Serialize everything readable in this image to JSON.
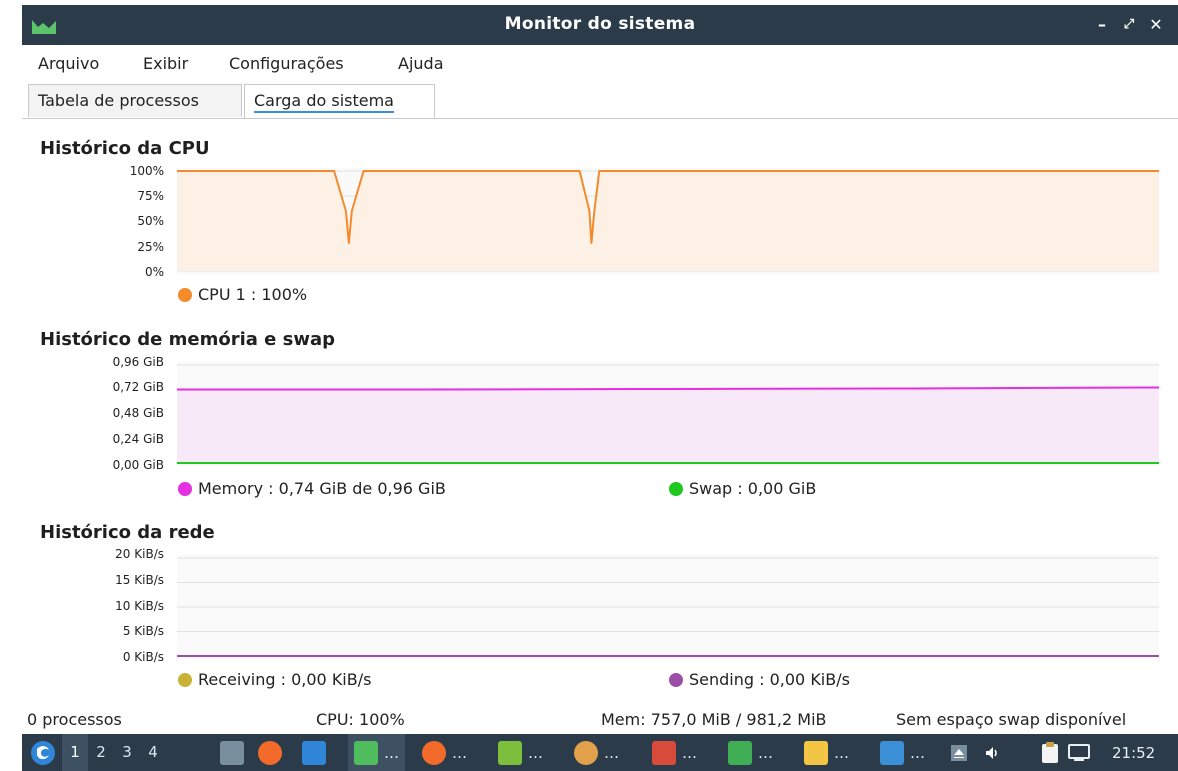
{
  "window": {
    "title": "Monitor do sistema"
  },
  "menu": [
    "Arquivo",
    "Exibir",
    "Configurações",
    "Ajuda"
  ],
  "tabs": [
    {
      "label": "Tabela de processos",
      "active": false
    },
    {
      "label": "Carga do sistema",
      "active": true
    }
  ],
  "cpu": {
    "title": "Histórico da CPU",
    "yticks": [
      "100%",
      "75%",
      "50%",
      "25%",
      "0%"
    ],
    "legend": "CPU 1 : 100%",
    "color": "#f58a2a",
    "fill": "#fdf1e6"
  },
  "memory": {
    "title": "Histórico de memória e swap",
    "yticks": [
      "0,96 GiB",
      "0,72 GiB",
      "0,48 GiB",
      "0,24 GiB",
      "0,00 GiB"
    ],
    "legend_memory": "Memory : 0,74 GiB de 0,96 GiB",
    "legend_swap": "Swap : 0,00 GiB",
    "memory_color": "#e62fe0",
    "swap_color": "#1ec81e",
    "fill": "#f7e9f7"
  },
  "network": {
    "title": "Histórico da rede",
    "yticks": [
      "20 KiB/s",
      "15 KiB/s",
      "10 KiB/s",
      "5 KiB/s",
      "0 KiB/s"
    ],
    "legend_receiving": "Receiving : 0,00 KiB/s",
    "legend_sending": "Sending : 0,00 KiB/s",
    "receiving_color": "#c9b037",
    "sending_color": "#9a4ea8"
  },
  "status": {
    "processes": "0 processos",
    "cpu": "CPU: 100%",
    "mem": "Mem: 757,0 MiB / 981,2 MiB",
    "swap": "Sem espaço swap disponível"
  },
  "taskbar": {
    "workspaces": [
      "1",
      "2",
      "3",
      "4"
    ],
    "ellipsis": "…",
    "clock": "21:52"
  },
  "chart_data": [
    {
      "type": "line",
      "title": "Histórico da CPU",
      "ylim": [
        0,
        100
      ],
      "series": [
        {
          "name": "CPU 1 : 100%",
          "x": [
            0,
            0.16,
            0.172,
            0.175,
            0.178,
            0.19,
            0.41,
            0.42,
            0.422,
            0.425,
            0.43,
            1
          ],
          "values": [
            100,
            100,
            60,
            28,
            60,
            100,
            100,
            60,
            28,
            60,
            100,
            100
          ]
        }
      ]
    },
    {
      "type": "line",
      "title": "Histórico de memória e swap",
      "ylim": [
        0,
        0.96
      ],
      "series": [
        {
          "name": "Memory : 0,74 GiB de 0,96 GiB",
          "x": [
            0,
            0.25,
            0.5,
            0.75,
            1
          ],
          "values": [
            0.72,
            0.72,
            0.725,
            0.73,
            0.74
          ]
        },
        {
          "name": "Swap : 0,00 GiB",
          "x": [
            0,
            1
          ],
          "values": [
            0,
            0
          ]
        }
      ]
    },
    {
      "type": "line",
      "title": "Histórico da rede",
      "ylim": [
        0,
        20
      ],
      "series": [
        {
          "name": "Receiving : 0,00 KiB/s",
          "x": [
            0,
            1
          ],
          "values": [
            0,
            0
          ]
        },
        {
          "name": "Sending : 0,00 KiB/s",
          "x": [
            0,
            1
          ],
          "values": [
            0,
            0
          ]
        }
      ]
    }
  ]
}
